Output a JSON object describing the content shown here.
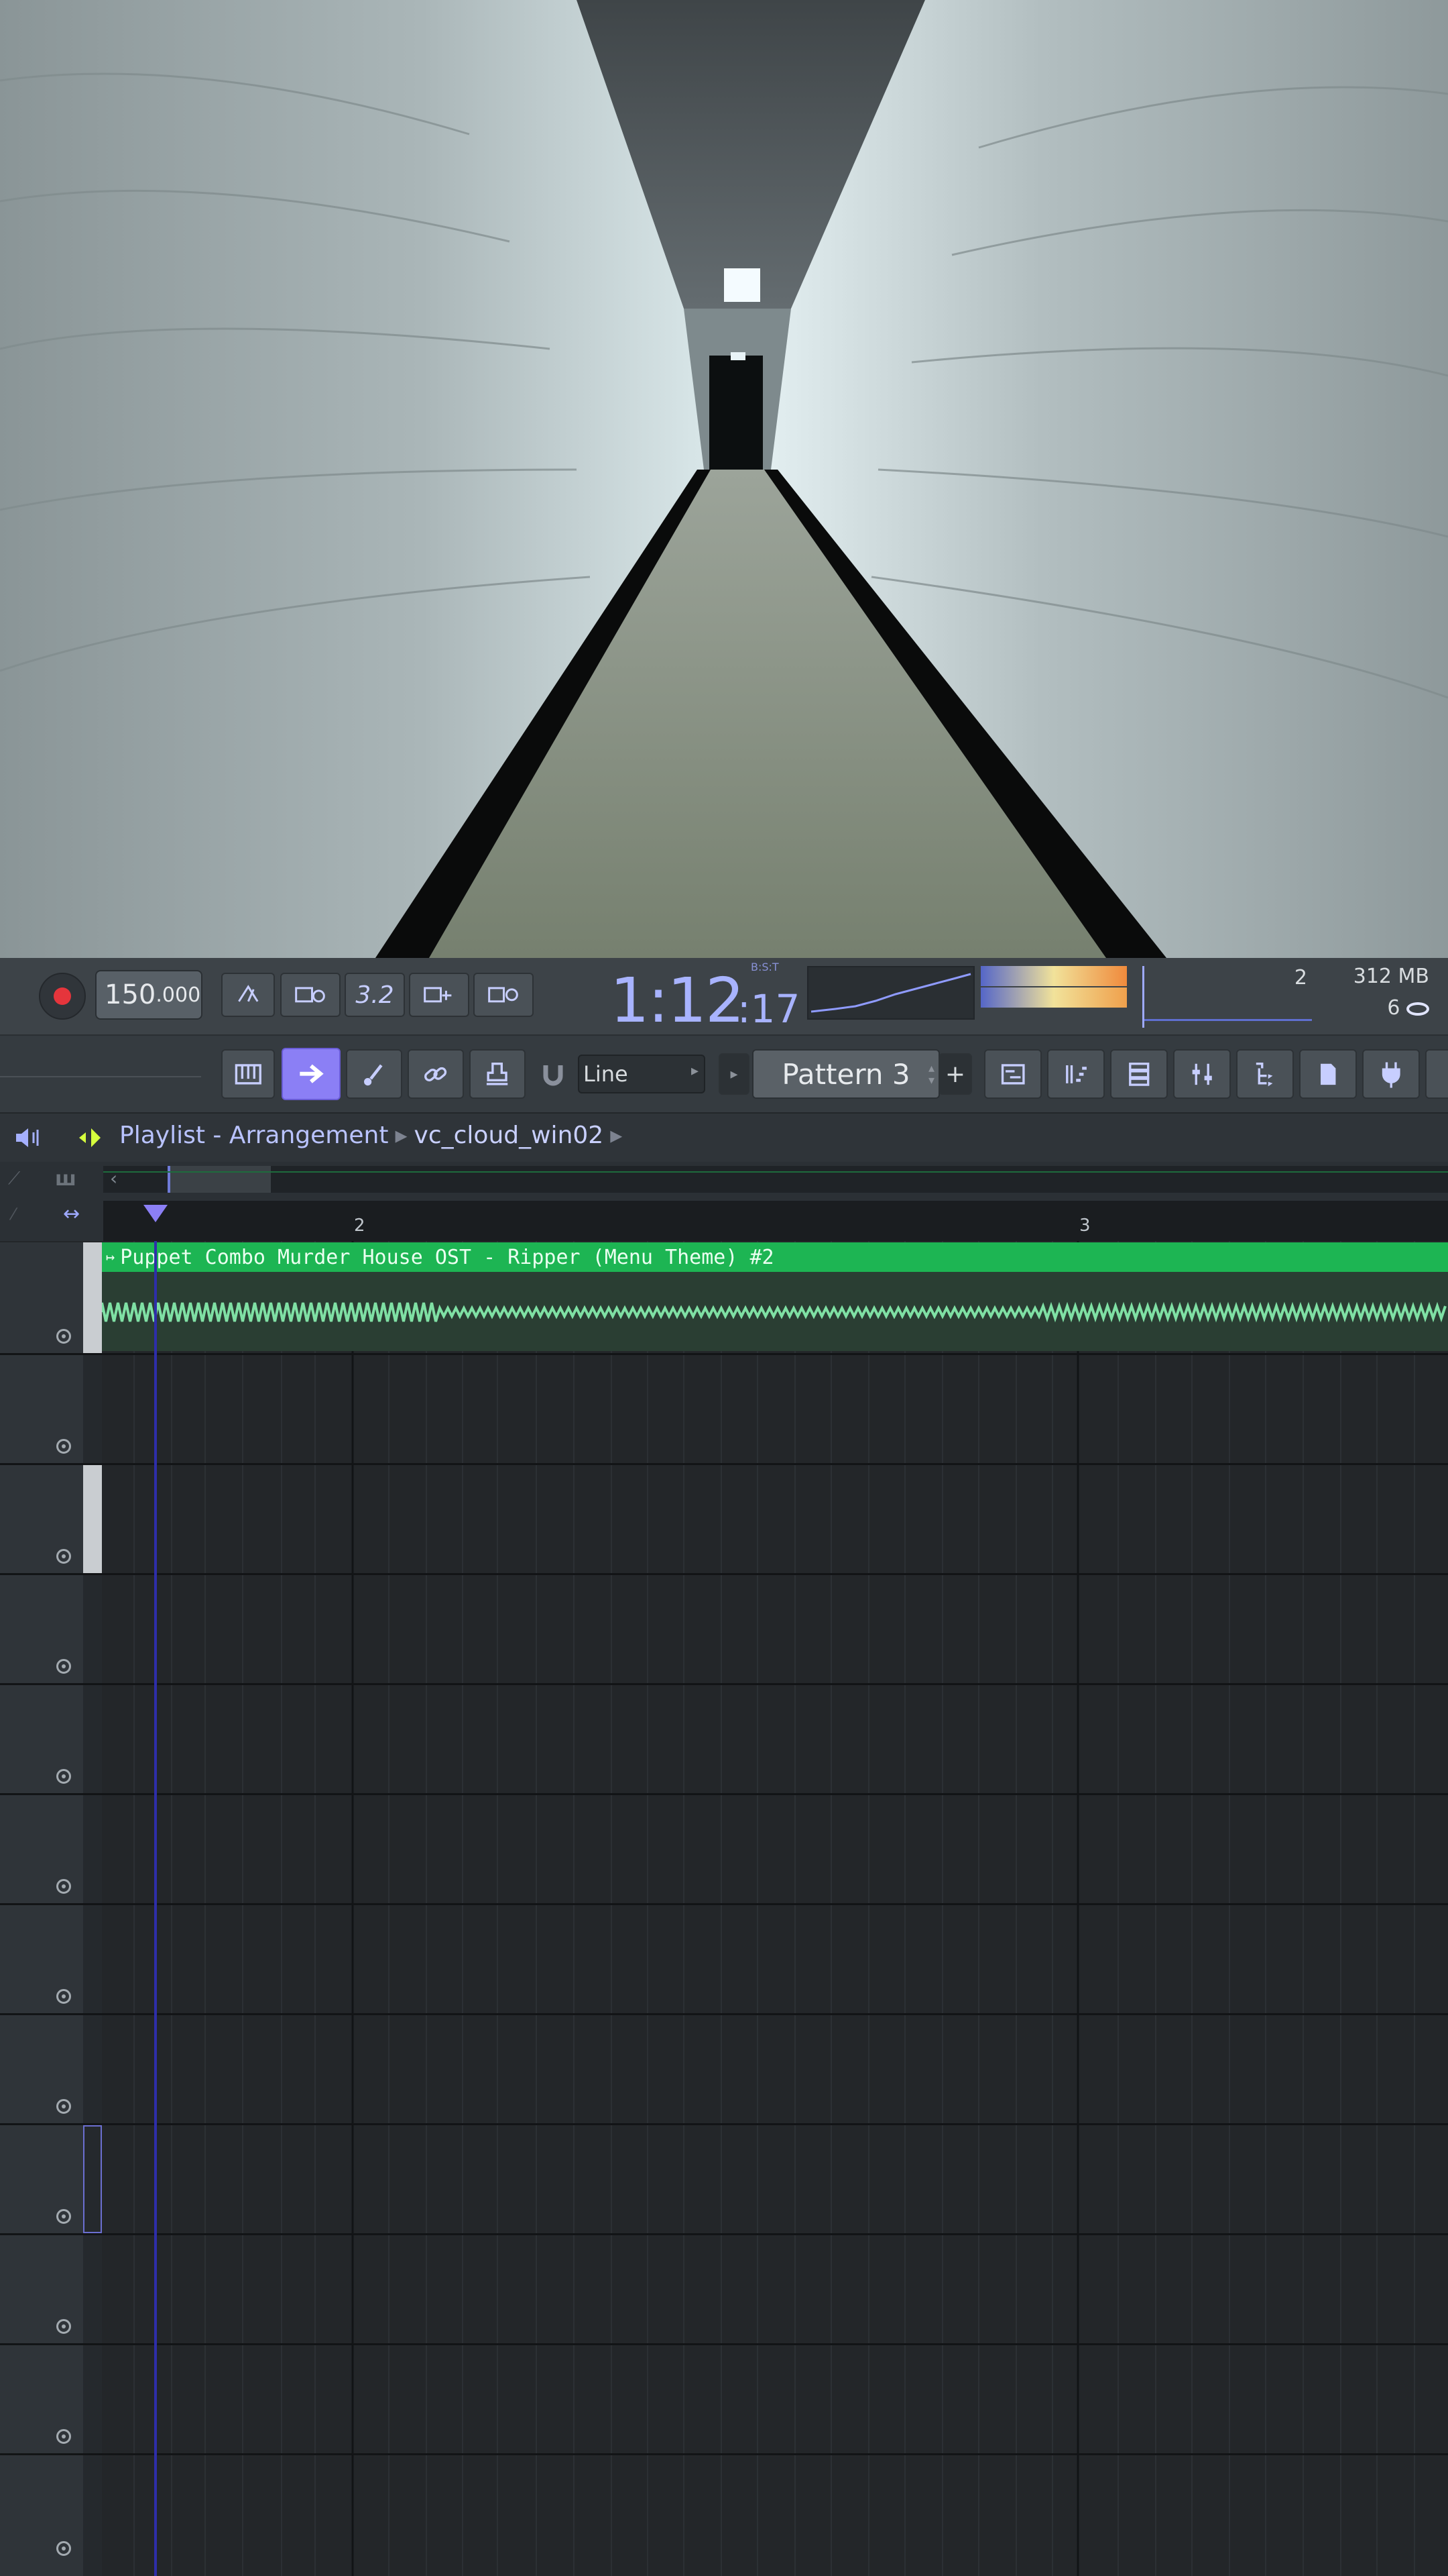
{
  "transport": {
    "tempo_value": "150",
    "tempo_decimals": ".000",
    "time_main": "1:12",
    "time_sub": ":17",
    "time_format_label": "B:S:T",
    "time_signature": "3.2"
  },
  "monitor": {
    "cpu_voices": "2",
    "memory": "312 MB",
    "polyphony": "6"
  },
  "toolbar": {
    "snap_mode": "Line",
    "pattern_name": "Pattern 3",
    "add_pattern": "+"
  },
  "playlist": {
    "window_title": "Playlist - Arrangement",
    "project_name": "vc_cloud_win02",
    "bar_markers": [
      "2",
      "3"
    ]
  },
  "clip": {
    "label": "Puppet Combo Murder House OST - Ripper (Menu Theme) #2",
    "color": "#1db553"
  },
  "icons": [
    "record-icon",
    "metronome-icon",
    "wait-for-input-icon",
    "countdown-icon",
    "step-edit-icon",
    "loop-record-icon",
    "piano-roll-icon",
    "arrow-icon",
    "brush-icon",
    "link-icon",
    "stamp-icon",
    "magnet-icon",
    "playlist-icon",
    "channel-rack-icon",
    "step-sequencer-icon",
    "mixer-icon",
    "browser-icon",
    "project-icon",
    "plugin-icon",
    "speaker-icon"
  ],
  "colors": {
    "accent": "#9ea9ff",
    "record": "#e5353c",
    "clip_green": "#1db553"
  }
}
